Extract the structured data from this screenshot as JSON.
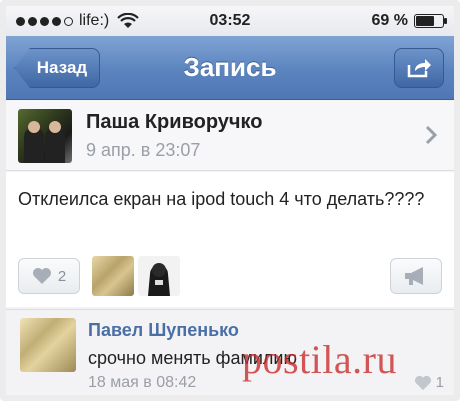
{
  "status_bar": {
    "carrier": "life:)",
    "time": "03:52",
    "battery_percent": "69 %",
    "battery_level": 0.69
  },
  "nav": {
    "back_label": "Назад",
    "title": "Запись"
  },
  "post": {
    "author": "Паша Криворучко",
    "date": "9 апр. в 23:07",
    "text": "Отклеилса екран на ipod touch 4 что делать????",
    "like_count": "2"
  },
  "comment": {
    "author": "Павел Шупенько",
    "text": "срочно менять фамилию",
    "date": "18 мая в 08:42",
    "like_count": "1"
  },
  "watermark": "postila.ru",
  "colors": {
    "nav_blue": "#5b84bf",
    "link_blue": "#4a6fa5",
    "watermark_red": "#c82828"
  }
}
